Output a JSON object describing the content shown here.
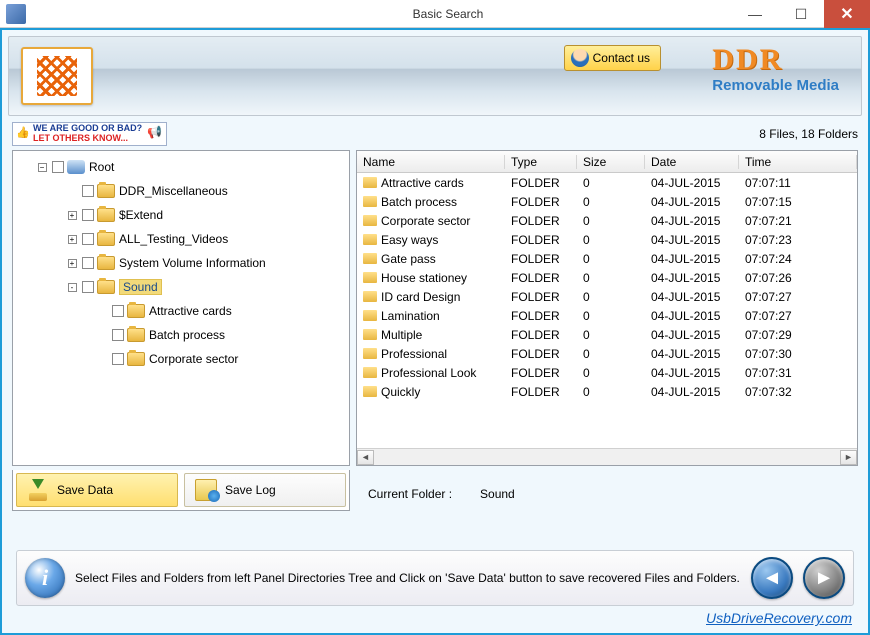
{
  "window": {
    "title": "Basic Search"
  },
  "banner": {
    "contact_label": "Contact us",
    "brand_main": "DDR",
    "brand_sub": "Removable Media"
  },
  "promo": {
    "line1": "WE ARE GOOD OR BAD?",
    "line2": "LET OTHERS KNOW..."
  },
  "counts": {
    "text": "8 Files, 18 Folders"
  },
  "tree": {
    "root_label": "Root",
    "nodes": [
      {
        "label": "DDR_Miscellaneous",
        "indent": 2,
        "exp": ""
      },
      {
        "label": "$Extend",
        "indent": 2,
        "exp": "+"
      },
      {
        "label": "ALL_Testing_Videos",
        "indent": 2,
        "exp": "+"
      },
      {
        "label": "System Volume Information",
        "indent": 2,
        "exp": "+"
      },
      {
        "label": "Sound",
        "indent": 2,
        "exp": "-",
        "selected": true
      },
      {
        "label": "Attractive cards",
        "indent": 3,
        "exp": ""
      },
      {
        "label": "Batch process",
        "indent": 3,
        "exp": ""
      },
      {
        "label": "Corporate sector",
        "indent": 3,
        "exp": ""
      }
    ]
  },
  "table": {
    "headers": {
      "name": "Name",
      "type": "Type",
      "size": "Size",
      "date": "Date",
      "time": "Time"
    },
    "rows": [
      {
        "name": "Attractive cards",
        "type": "FOLDER",
        "size": "0",
        "date": "04-JUL-2015",
        "time": "07:07:11"
      },
      {
        "name": "Batch process",
        "type": "FOLDER",
        "size": "0",
        "date": "04-JUL-2015",
        "time": "07:07:15"
      },
      {
        "name": "Corporate sector",
        "type": "FOLDER",
        "size": "0",
        "date": "04-JUL-2015",
        "time": "07:07:21"
      },
      {
        "name": "Easy ways",
        "type": "FOLDER",
        "size": "0",
        "date": "04-JUL-2015",
        "time": "07:07:23"
      },
      {
        "name": "Gate pass",
        "type": "FOLDER",
        "size": "0",
        "date": "04-JUL-2015",
        "time": "07:07:24"
      },
      {
        "name": "House stationey",
        "type": "FOLDER",
        "size": "0",
        "date": "04-JUL-2015",
        "time": "07:07:26"
      },
      {
        "name": "ID card Design",
        "type": "FOLDER",
        "size": "0",
        "date": "04-JUL-2015",
        "time": "07:07:27"
      },
      {
        "name": "Lamination",
        "type": "FOLDER",
        "size": "0",
        "date": "04-JUL-2015",
        "time": "07:07:27"
      },
      {
        "name": "Multiple",
        "type": "FOLDER",
        "size": "0",
        "date": "04-JUL-2015",
        "time": "07:07:29"
      },
      {
        "name": "Professional",
        "type": "FOLDER",
        "size": "0",
        "date": "04-JUL-2015",
        "time": "07:07:30"
      },
      {
        "name": "Professional Look",
        "type": "FOLDER",
        "size": "0",
        "date": "04-JUL-2015",
        "time": "07:07:31"
      },
      {
        "name": "Quickly",
        "type": "FOLDER",
        "size": "0",
        "date": "04-JUL-2015",
        "time": "07:07:32"
      }
    ]
  },
  "actions": {
    "save_data": "Save Data",
    "save_log": "Save Log"
  },
  "current": {
    "label": "Current Folder :",
    "value": "Sound"
  },
  "footer": {
    "text": "Select Files and Folders from left Panel Directories Tree and Click on 'Save Data' button to save recovered Files and Folders."
  },
  "site": {
    "link": "UsbDriveRecovery.com"
  }
}
